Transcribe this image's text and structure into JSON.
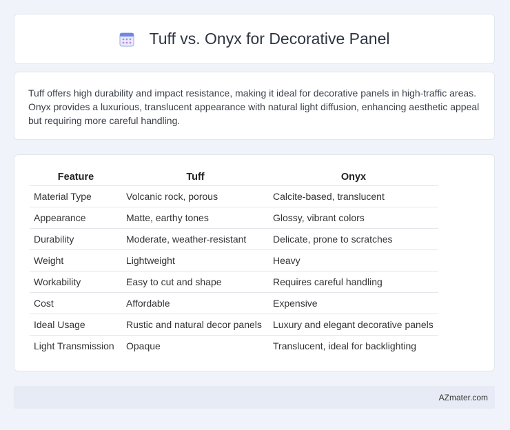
{
  "header": {
    "title": "Tuff vs. Onyx for Decorative Panel",
    "icon": "calendar-grid-icon"
  },
  "summary": "Tuff offers high durability and impact resistance, making it ideal for decorative panels in high-traffic areas. Onyx provides a luxurious, translucent appearance with natural light diffusion, enhancing aesthetic appeal but requiring more careful handling.",
  "table": {
    "headers": [
      "Feature",
      "Tuff",
      "Onyx"
    ],
    "rows": [
      [
        "Material Type",
        "Volcanic rock, porous",
        "Calcite-based, translucent"
      ],
      [
        "Appearance",
        "Matte, earthy tones",
        "Glossy, vibrant colors"
      ],
      [
        "Durability",
        "Moderate, weather-resistant",
        "Delicate, prone to scratches"
      ],
      [
        "Weight",
        "Lightweight",
        "Heavy"
      ],
      [
        "Workability",
        "Easy to cut and shape",
        "Requires careful handling"
      ],
      [
        "Cost",
        "Affordable",
        "Expensive"
      ],
      [
        "Ideal Usage",
        "Rustic and natural decor panels",
        "Luxury and elegant decorative panels"
      ],
      [
        "Light Transmission",
        "Opaque",
        "Translucent, ideal for backlighting"
      ]
    ]
  },
  "footer": {
    "brand": "AZmater.com"
  }
}
